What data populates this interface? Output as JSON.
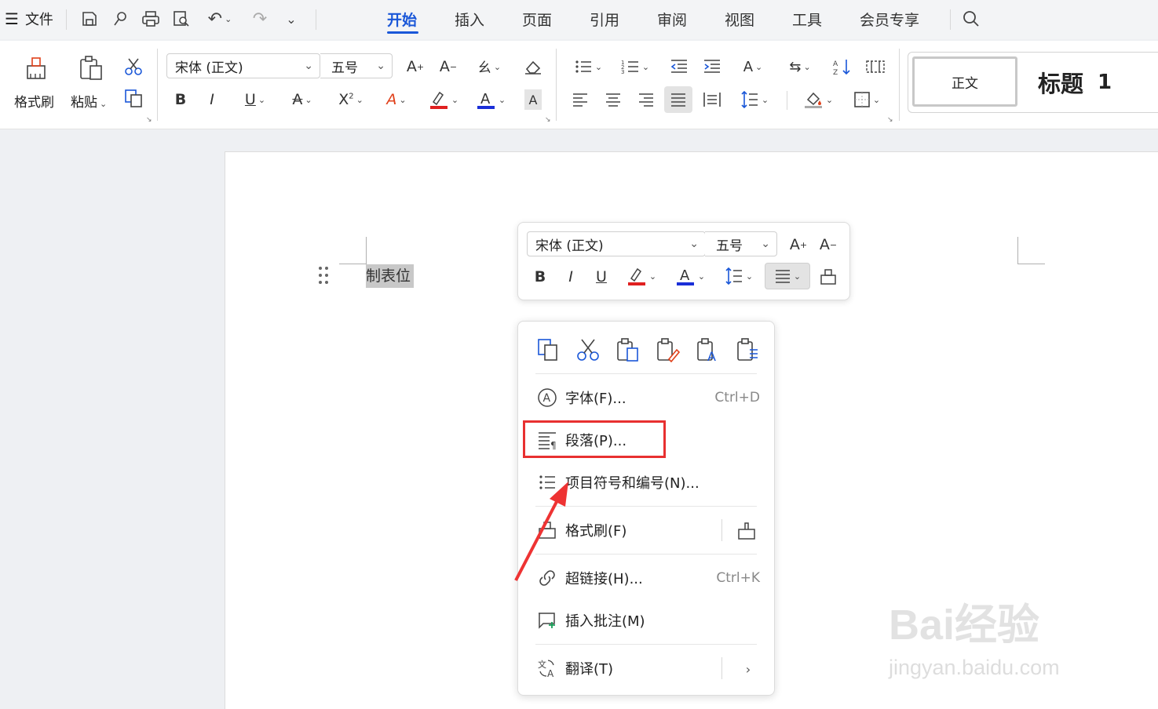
{
  "menubar": {
    "file_label": "文件",
    "tabs": [
      {
        "label": "开始",
        "active": true
      },
      {
        "label": "插入"
      },
      {
        "label": "页面"
      },
      {
        "label": "引用"
      },
      {
        "label": "审阅"
      },
      {
        "label": "视图"
      },
      {
        "label": "工具"
      },
      {
        "label": "会员专享"
      }
    ],
    "accent_color": "#1a57d8"
  },
  "ribbon": {
    "format_painter_label": "格式刷",
    "paste_label": "粘贴",
    "font_name": "宋体 (正文)",
    "font_size": "五号",
    "styles": {
      "normal_label": "正文",
      "heading1_label": "标题",
      "heading1_number": "1"
    },
    "highlight_color": "#e02020",
    "font_color": "#1a2fd8"
  },
  "document": {
    "selected_text": "制表位"
  },
  "minibar": {
    "font_name": "宋体 (正文)",
    "font_size": "五号"
  },
  "context_menu": {
    "items": [
      {
        "label": "字体(F)...",
        "shortcut": "Ctrl+D",
        "icon": "font-circle-a-icon"
      },
      {
        "label": "段落(P)...",
        "shortcut": "",
        "icon": "paragraph-icon",
        "highlighted": true
      },
      {
        "label": "项目符号和编号(N)...",
        "shortcut": "",
        "icon": "bullet-list-icon"
      },
      {
        "label": "格式刷(F)",
        "shortcut": "",
        "icon": "format-painter-icon"
      },
      {
        "label": "超链接(H)...",
        "shortcut": "Ctrl+K",
        "icon": "link-icon"
      },
      {
        "label": "插入批注(M)",
        "shortcut": "",
        "icon": "comment-add-icon"
      },
      {
        "label": "翻译(T)",
        "shortcut": "",
        "icon": "translate-icon"
      }
    ],
    "highlight_box_color": "#e83030"
  },
  "watermark": {
    "brand": "Bai经验",
    "url": "jingyan.baidu.com"
  }
}
